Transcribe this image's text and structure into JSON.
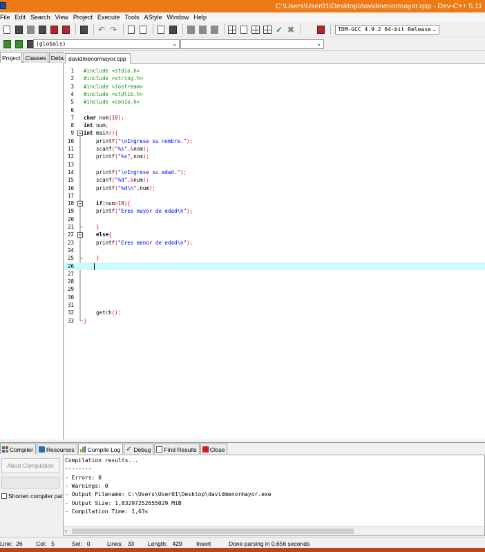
{
  "window": {
    "title": "C:\\Users\\User01\\Desktop\\davidmenormayor.cpp - Dev-C++ 5.11"
  },
  "menu": [
    "File",
    "Edit",
    "Search",
    "View",
    "Project",
    "Execute",
    "Tools",
    "AStyle",
    "Window",
    "Help"
  ],
  "toolbar": {
    "compiler": "TDM-GCC 4.9.2 64-bit Release",
    "scope": "(globals)",
    "member": ""
  },
  "left_tabs": [
    "Project",
    "Classes",
    "Debug"
  ],
  "editor": {
    "file_tab": "davidmenormayor.cpp",
    "current_line": 26,
    "lines": [
      [
        [
          "pre",
          "#include <stdio.h>"
        ]
      ],
      [
        [
          "pre",
          "#include <string.h>"
        ]
      ],
      [
        [
          "pre",
          "#include <iostream>"
        ]
      ],
      [
        [
          "pre",
          "#include <stdlib.h>"
        ]
      ],
      [
        [
          "pre",
          "#include <conio.h>"
        ]
      ],
      [],
      [
        [
          "kw",
          "char"
        ],
        [
          "txt",
          " nom"
        ],
        [
          "sym",
          "["
        ],
        [
          "num",
          "10"
        ],
        [
          "sym",
          "];"
        ]
      ],
      [
        [
          "kw",
          "int"
        ],
        [
          "txt",
          " num"
        ],
        [
          "sym",
          ";"
        ]
      ],
      [
        [
          "kw",
          "int"
        ],
        [
          "txt",
          " main"
        ],
        [
          "sym",
          "(){"
        ]
      ],
      [
        [
          "txt",
          "    printf"
        ],
        [
          "sym",
          "("
        ],
        [
          "str",
          "\"\\nIngrese su nombre.\""
        ],
        [
          "sym",
          ");"
        ]
      ],
      [
        [
          "txt",
          "    scanf"
        ],
        [
          "sym",
          "("
        ],
        [
          "str",
          "\"%s\""
        ],
        [
          "sym",
          ",&"
        ],
        [
          "txt",
          "nom"
        ],
        [
          "sym",
          ");"
        ]
      ],
      [
        [
          "txt",
          "    printf"
        ],
        [
          "sym",
          "("
        ],
        [
          "str",
          "\"%s\""
        ],
        [
          "sym",
          ","
        ],
        [
          "txt",
          "nom"
        ],
        [
          "sym",
          ");"
        ]
      ],
      [],
      [
        [
          "txt",
          "    printf"
        ],
        [
          "sym",
          "("
        ],
        [
          "str",
          "\"\\nIngrese su edad.\""
        ],
        [
          "sym",
          ");"
        ]
      ],
      [
        [
          "txt",
          "    scanf"
        ],
        [
          "sym",
          "("
        ],
        [
          "str",
          "\"%d\""
        ],
        [
          "sym",
          ",&"
        ],
        [
          "txt",
          "num"
        ],
        [
          "sym",
          ");"
        ]
      ],
      [
        [
          "txt",
          "    printf"
        ],
        [
          "sym",
          "("
        ],
        [
          "str",
          "\"%d\\n\""
        ],
        [
          "sym",
          ","
        ],
        [
          "txt",
          "num"
        ],
        [
          "sym",
          ");"
        ]
      ],
      [],
      [
        [
          "kw",
          "    if"
        ],
        [
          "sym",
          "("
        ],
        [
          "txt",
          "num"
        ],
        [
          "sym",
          ">"
        ],
        [
          "num",
          "18"
        ],
        [
          "sym",
          "){"
        ]
      ],
      [
        [
          "txt",
          "    printf"
        ],
        [
          "sym",
          "("
        ],
        [
          "str",
          "\"Eres mayor de edad\\n\""
        ],
        [
          "sym",
          ");"
        ]
      ],
      [],
      [
        [
          "sym",
          "    }"
        ]
      ],
      [
        [
          "kw",
          "    else"
        ],
        [
          "sym",
          "{"
        ]
      ],
      [
        [
          "txt",
          "    printf"
        ],
        [
          "sym",
          "("
        ],
        [
          "str",
          "\"Eres menor de edad\\n\""
        ],
        [
          "sym",
          ");"
        ]
      ],
      [],
      [
        [
          "sym",
          "    }"
        ]
      ],
      [],
      [],
      [],
      [],
      [],
      [],
      [
        [
          "txt",
          "    getch"
        ],
        [
          "sym",
          "();"
        ]
      ],
      [
        [
          "sym",
          "}"
        ]
      ]
    ]
  },
  "bottom_tabs": [
    {
      "label": "Compiler",
      "icon": "compiler-icon"
    },
    {
      "label": "Resources",
      "icon": "resources-icon"
    },
    {
      "label": "Compile Log",
      "icon": "compile-log-icon"
    },
    {
      "label": "Debug",
      "icon": "debug-icon"
    },
    {
      "label": "Find Results",
      "icon": "find-results-icon"
    },
    {
      "label": "Close",
      "icon": "close-icon"
    }
  ],
  "compile_panel": {
    "abort_label": "Abort Compilation",
    "shorten_label": "Shorten compiler paths",
    "log": [
      "Compilation results...",
      "--------",
      "- Errors: 0",
      "- Warnings: 0",
      "- Output Filename: C:\\Users\\User01\\Desktop\\davidmenormayor.exe",
      "- Output Size: 1,83297252655029 MiB",
      "- Compilation Time: 1,63s"
    ]
  },
  "status": {
    "line_label": "Line:",
    "line": "26",
    "col_label": "Col:",
    "col": "5",
    "sel_label": "Sel:",
    "sel": "0",
    "lines_label": "Lines:",
    "lines": "33",
    "length_label": "Length:",
    "length": "429",
    "mode": "Insert",
    "message": "Done parsing in 0,656 seconds"
  }
}
